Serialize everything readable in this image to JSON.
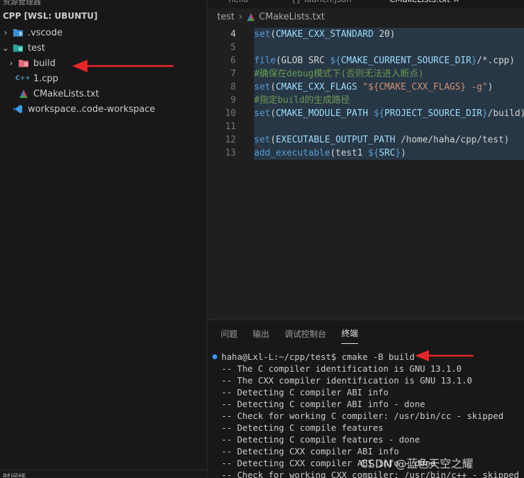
{
  "sidebar": {
    "top_cut": "资源管理器",
    "root": "CPP [WSL: UBUNTU]",
    "items": [
      {
        "label": ".vscode",
        "chevron": "›",
        "icon": "folder-vscode-icon"
      },
      {
        "label": "test",
        "chevron": "⌄",
        "icon": "folder-test-icon"
      },
      {
        "label": "build",
        "chevron": "›",
        "icon": "folder-build-icon"
      },
      {
        "label": "1.cpp",
        "chevron": "",
        "icon": "cpp-file-icon",
        "glyph": "C++"
      },
      {
        "label": "CMakeLists.txt",
        "chevron": "",
        "icon": "cmake-file-icon"
      },
      {
        "label": "workspace..code-workspace",
        "chevron": "",
        "icon": "vscode-workspace-icon"
      }
    ],
    "bottom_cut": "时间线"
  },
  "tabs": [
    {
      "label": "hello"
    },
    {
      "label": "{} launch.json"
    },
    {
      "label": "CMakeLists.txt ×"
    }
  ],
  "breadcrumb": {
    "folder": "test",
    "sep": "›",
    "file": "CMakeLists.txt"
  },
  "code": {
    "lines": [
      {
        "n": "4",
        "parts": [
          [
            "fn",
            "set"
          ],
          [
            "pl",
            "("
          ],
          [
            "vr",
            "CMAKE_CXX_STANDARD"
          ],
          [
            "pl",
            " 20)"
          ]
        ]
      },
      {
        "n": "5",
        "parts": []
      },
      {
        "n": "6",
        "parts": [
          [
            "fn",
            "file"
          ],
          [
            "pl",
            "(GLOB SRC "
          ],
          [
            "dl",
            "${"
          ],
          [
            "vr",
            "CMAKE_CURRENT_SOURCE_DIR"
          ],
          [
            "dl",
            "}"
          ],
          [
            "pl",
            "/*.cpp)"
          ]
        ]
      },
      {
        "n": "7",
        "parts": [
          [
            "cm",
            "#确保在debug模式下(否则无法进入断点)"
          ]
        ]
      },
      {
        "n": "8",
        "parts": [
          [
            "fn",
            "set"
          ],
          [
            "pl",
            "("
          ],
          [
            "vr",
            "CMAKE_CXX_FLAGS"
          ],
          [
            "pl",
            " "
          ],
          [
            "st",
            "\"${CMAKE_CXX_FLAGS} -g\""
          ],
          [
            "pl",
            ")"
          ]
        ]
      },
      {
        "n": "9",
        "parts": [
          [
            "cm",
            "#指定build的生成路径"
          ]
        ]
      },
      {
        "n": "10",
        "parts": [
          [
            "fn",
            "set"
          ],
          [
            "pl",
            "("
          ],
          [
            "vr",
            "CMAKE_MODULE_PATH"
          ],
          [
            "pl",
            " "
          ],
          [
            "dl",
            "${"
          ],
          [
            "vr",
            "PROJECT_SOURCE_DIR"
          ],
          [
            "dl",
            "}"
          ],
          [
            "pl",
            "/build)"
          ]
        ]
      },
      {
        "n": "11",
        "parts": []
      },
      {
        "n": "12",
        "parts": [
          [
            "fn",
            "set"
          ],
          [
            "pl",
            "("
          ],
          [
            "vr",
            "EXECUTABLE_OUTPUT_PATH"
          ],
          [
            "pl",
            " /home/haha/cpp/test)"
          ]
        ]
      },
      {
        "n": "13",
        "parts": [
          [
            "fn",
            "add_executable"
          ],
          [
            "pl",
            "(test1 "
          ],
          [
            "dl",
            "${"
          ],
          [
            "vr",
            "SRC"
          ],
          [
            "dl",
            "}"
          ],
          [
            "pl",
            ")"
          ]
        ]
      }
    ]
  },
  "panel": {
    "tabs": [
      {
        "label": "问题",
        "active": false
      },
      {
        "label": "输出",
        "active": false
      },
      {
        "label": "调试控制台",
        "active": false
      },
      {
        "label": "终端",
        "active": true
      }
    ],
    "terminal_lines": [
      "haha@Lxl-L:~/cpp/test$ cmake -B build",
      "-- The C compiler identification is GNU 13.1.0",
      "-- The CXX compiler identification is GNU 13.1.0",
      "-- Detecting C compiler ABI info",
      "-- Detecting C compiler ABI info - done",
      "-- Check for working C compiler: /usr/bin/cc - skipped",
      "-- Detecting C compile features",
      "-- Detecting C compile features - done",
      "-- Detecting CXX compiler ABI info",
      "-- Detecting CXX compiler ABI info - done",
      "-- Check for working CXX compiler: /usr/bin/c++ - skipped"
    ]
  },
  "watermark": "CSDN @蓝色天空之耀",
  "colors": {
    "arrow": "#e8262a",
    "accent": "#3794ff"
  }
}
